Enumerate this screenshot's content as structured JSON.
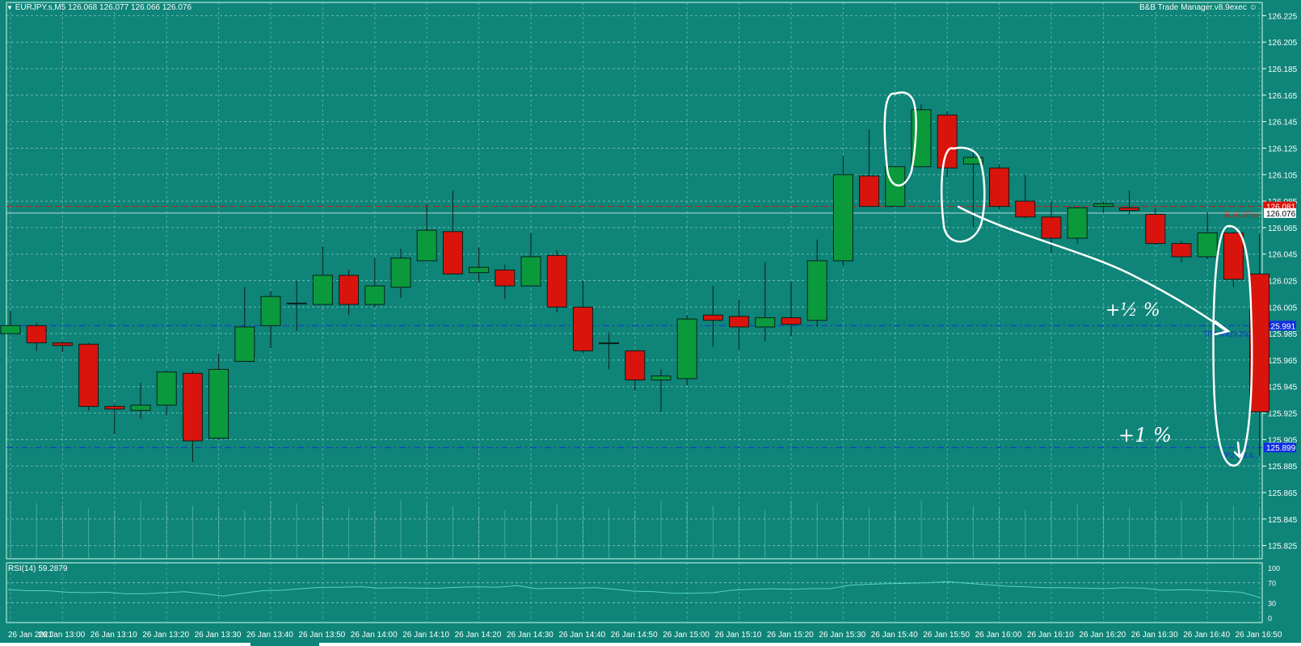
{
  "header": {
    "symbol_line": "EURJPY.s,M5  126.068 126.077 126.066 126.076",
    "expert": "B&B Trade Manager.v8.9exec ☺"
  },
  "rsi": {
    "label": "RSI(14) 59.2879",
    "levels": [
      "100",
      "70",
      "30",
      "0"
    ],
    "level_values": [
      100,
      70,
      30,
      0
    ],
    "values": [
      56,
      54,
      54,
      51,
      50,
      51,
      48,
      48,
      50,
      52,
      48,
      43,
      49,
      54,
      55,
      58,
      61,
      61,
      62,
      59,
      60,
      59,
      59,
      61,
      62,
      61,
      64,
      58,
      59,
      59,
      60,
      57,
      53,
      52,
      49,
      49,
      50,
      55,
      57,
      58,
      57,
      58,
      58,
      65,
      67,
      68,
      69,
      70,
      72,
      69,
      66,
      63,
      62,
      60,
      60,
      59,
      58,
      60,
      59,
      55,
      56,
      55,
      53,
      51,
      40
    ]
  },
  "annotations": {
    "half_percent": "+½ %",
    "one_percent": "+1 %"
  },
  "colors": {
    "background": "#0f8478",
    "bull": "#0a9a3c",
    "bear": "#d9140c",
    "wick": "#0a1e1a",
    "sl_line": "#d9140c",
    "tp_line": "#1030e0",
    "grid": "#8fd1c6",
    "annotation": "#ffffff"
  },
  "chart_data": {
    "type": "candlestick",
    "symbol": "EURJPY.s",
    "timeframe": "M5",
    "y_range": [
      125.815,
      126.235
    ],
    "y_ticks": [
      "126.225",
      "126.205",
      "126.185",
      "126.165",
      "126.145",
      "126.125",
      "126.105",
      "126.085",
      "126.065",
      "126.045",
      "126.025",
      "126.005",
      "125.985",
      "125.965",
      "125.945",
      "125.925",
      "125.905",
      "125.885",
      "125.865",
      "125.845",
      "125.825"
    ],
    "tick_values": [
      126.225,
      126.205,
      126.185,
      126.165,
      126.145,
      126.125,
      126.105,
      126.085,
      126.065,
      126.045,
      126.025,
      126.005,
      125.985,
      125.965,
      125.945,
      125.925,
      125.905,
      125.885,
      125.865,
      125.845,
      125.825
    ],
    "x_ticks": [
      "26 Jan 2021",
      "26 Jan 13:00",
      "26 Jan 13:10",
      "26 Jan 13:20",
      "26 Jan 13:30",
      "26 Jan 13:40",
      "26 Jan 13:50",
      "26 Jan 14:00",
      "26 Jan 14:10",
      "26 Jan 14:20",
      "26 Jan 14:30",
      "26 Jan 14:40",
      "26 Jan 14:50",
      "26 Jan 15:00",
      "26 Jan 15:10",
      "26 Jan 15:20",
      "26 Jan 15:30",
      "26 Jan 15:40",
      "26 Jan 15:50",
      "26 Jan 16:00",
      "26 Jan 16:10",
      "26 Jan 16:20",
      "26 Jan 16:30",
      "26 Jan 16:40",
      "26 Jan 16:50"
    ],
    "candles": [
      [
        125.985,
        125.991,
        125.985,
        126.002
      ],
      [
        125.991,
        125.978,
        125.972,
        125.993
      ],
      [
        125.978,
        125.976,
        125.971,
        125.979
      ],
      [
        125.977,
        125.93,
        125.927,
        125.978
      ],
      [
        125.93,
        125.928,
        125.909,
        125.932
      ],
      [
        125.927,
        125.931,
        125.921,
        125.948
      ],
      [
        125.931,
        125.956,
        125.923,
        125.957
      ],
      [
        125.955,
        125.904,
        125.888,
        125.957
      ],
      [
        125.906,
        125.958,
        125.905,
        125.97
      ],
      [
        125.964,
        125.99,
        125.964,
        126.02
      ],
      [
        125.991,
        126.013,
        125.974,
        126.017
      ],
      [
        126.008,
        126.008,
        125.987,
        126.025
      ],
      [
        126.007,
        126.029,
        126.007,
        126.051
      ],
      [
        126.029,
        126.007,
        125.999,
        126.033
      ],
      [
        126.007,
        126.021,
        126.005,
        126.042
      ],
      [
        126.02,
        126.042,
        126.012,
        126.049
      ],
      [
        126.04,
        126.063,
        126.04,
        126.083
      ],
      [
        126.062,
        126.03,
        126.03,
        126.093
      ],
      [
        126.031,
        126.035,
        126.024,
        126.05
      ],
      [
        126.033,
        126.021,
        126.011,
        126.037
      ],
      [
        126.021,
        126.043,
        126.021,
        126.061
      ],
      [
        126.044,
        126.005,
        126.001,
        126.048
      ],
      [
        126.005,
        125.972,
        125.97,
        126.025
      ],
      [
        125.978,
        125.978,
        125.958,
        125.986
      ],
      [
        125.972,
        125.95,
        125.942,
        125.972
      ],
      [
        125.95,
        125.953,
        125.926,
        125.958
      ],
      [
        125.951,
        125.996,
        125.946,
        125.999
      ],
      [
        125.999,
        125.995,
        125.975,
        126.021
      ],
      [
        125.998,
        125.99,
        125.973,
        126.011
      ],
      [
        125.99,
        125.997,
        125.979,
        126.039
      ],
      [
        125.997,
        125.992,
        125.983,
        126.024
      ],
      [
        125.995,
        126.04,
        125.99,
        126.056
      ],
      [
        126.04,
        126.105,
        126.036,
        126.119
      ],
      [
        126.104,
        126.081,
        126.081,
        126.139
      ],
      [
        126.081,
        126.111,
        126.081,
        126.111
      ],
      [
        126.111,
        126.154,
        126.111,
        126.158
      ],
      [
        126.15,
        126.11,
        126.103,
        126.153
      ],
      [
        126.113,
        126.118,
        126.065,
        126.123
      ],
      [
        126.11,
        126.081,
        126.079,
        126.113
      ],
      [
        126.085,
        126.073,
        126.072,
        126.105
      ],
      [
        126.073,
        126.057,
        126.046,
        126.085
      ],
      [
        126.057,
        126.08,
        126.053,
        126.08
      ],
      [
        126.081,
        126.083,
        126.076,
        126.085
      ],
      [
        126.08,
        126.078,
        126.075,
        126.093
      ],
      [
        126.075,
        126.053,
        126.052,
        126.08
      ],
      [
        126.053,
        126.043,
        126.039,
        126.055
      ],
      [
        126.043,
        126.061,
        126.041,
        126.077
      ],
      [
        126.061,
        126.026,
        126.02,
        126.062
      ],
      [
        126.03,
        125.926,
        125.893,
        126.06
      ]
    ],
    "levels": [
      {
        "name": "SL",
        "label": "SL (0.2Pts)",
        "price_label": "126.081",
        "value": 126.081
      },
      {
        "name": "TP1",
        "label": "TP1 B/E(9.25pts)",
        "price_label": "125.991",
        "value": 125.991
      },
      {
        "name": "TP2",
        "label": "TP2 (18.4...",
        "price_label": "125.899",
        "value": 125.899
      },
      {
        "name": "Bid",
        "label": "",
        "price_label": "126.076",
        "value": 126.076
      }
    ]
  }
}
